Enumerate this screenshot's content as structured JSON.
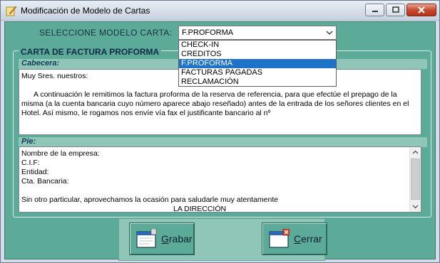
{
  "window": {
    "title": "Modificación de Modelo de Cartas"
  },
  "selector": {
    "label": "SELECCIONE MODELO CARTA:",
    "selected": "F.PROFORMA",
    "options": [
      "CHECK-IN",
      "CREDITOS",
      "F.PROFORMA",
      "FACTURAS PAGADAS",
      "RECLAMACIÓN"
    ],
    "selected_index": 2
  },
  "letter": {
    "frame_title": "CARTA DE FACTURA PROFORMA",
    "header_label": "Cabecera:",
    "header_lines": [
      "Muy Sres. nuestros:",
      "",
      "A continuación le remitimos la factura proforma de la reserva de referencia, para que efectúe el prepago de la",
      "misma (a la cuenta bancaria cuyo número aparece abajo reseñado) antes de la entrada de los señores clientes en el",
      "Hotel. Así mismo, le rogamos nos envíe vía fax el justificante bancario al nº"
    ],
    "footer_label": "Pie:",
    "footer_lines": [
      "Nombre de la empresa:",
      "C.I.F:",
      "Entidad:",
      "Cta. Bancaria:",
      "",
      "Sin otro particular, aprovechamos la ocasión para saludarle muy atentamente",
      "LA DIRECCIÓN"
    ]
  },
  "buttons": {
    "save_first": "G",
    "save_rest": "rabar",
    "close_first": "C",
    "close_rest": "errar"
  },
  "colors": {
    "panel_green": "#5cab98",
    "section_band": "#8fc6b8",
    "selection_blue": "#1e73c8",
    "close_red": "#c7492f"
  }
}
